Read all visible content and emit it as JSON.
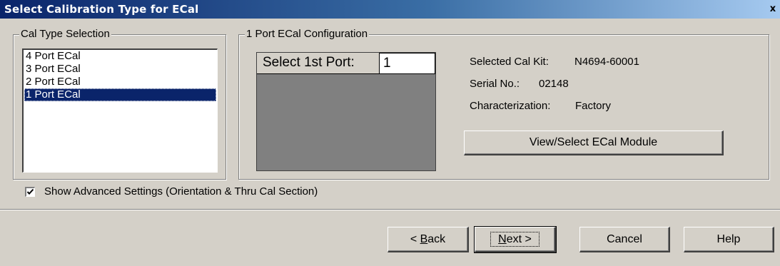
{
  "window": {
    "title": "Select Calibration Type for ECal",
    "close_glyph": "x"
  },
  "cal_type_group": {
    "legend": "Cal Type Selection",
    "items": [
      {
        "label": "4 Port ECal",
        "selected": false
      },
      {
        "label": "3 Port ECal",
        "selected": false
      },
      {
        "label": "2 Port ECal",
        "selected": false
      },
      {
        "label": "1 Port ECal",
        "selected": true
      }
    ]
  },
  "config_group": {
    "legend": "1 Port ECal Configuration",
    "port_label": "Select 1st Port:",
    "port_value": "1",
    "cal_kit_label": "Selected Cal Kit:",
    "cal_kit_value": "N4694-60001",
    "serial_label": "Serial No.:",
    "serial_value": "02148",
    "characterization_label": "Characterization:",
    "characterization_value": "Factory",
    "view_select_button": "View/Select ECal Module"
  },
  "advanced": {
    "label": "Show Advanced Settings (Orientation & Thru Cal Section)",
    "checked": true
  },
  "buttons": {
    "back_prefix": "< ",
    "back_mnemonic": "B",
    "back_rest": "ack",
    "next_mnemonic": "N",
    "next_rest": "ext >",
    "cancel": "Cancel",
    "help": "Help"
  },
  "colors": {
    "title_bar": "#0a246a",
    "selection": "#0a246a",
    "dialog_bg": "#d4d0c8",
    "panel_gray": "#808080"
  }
}
